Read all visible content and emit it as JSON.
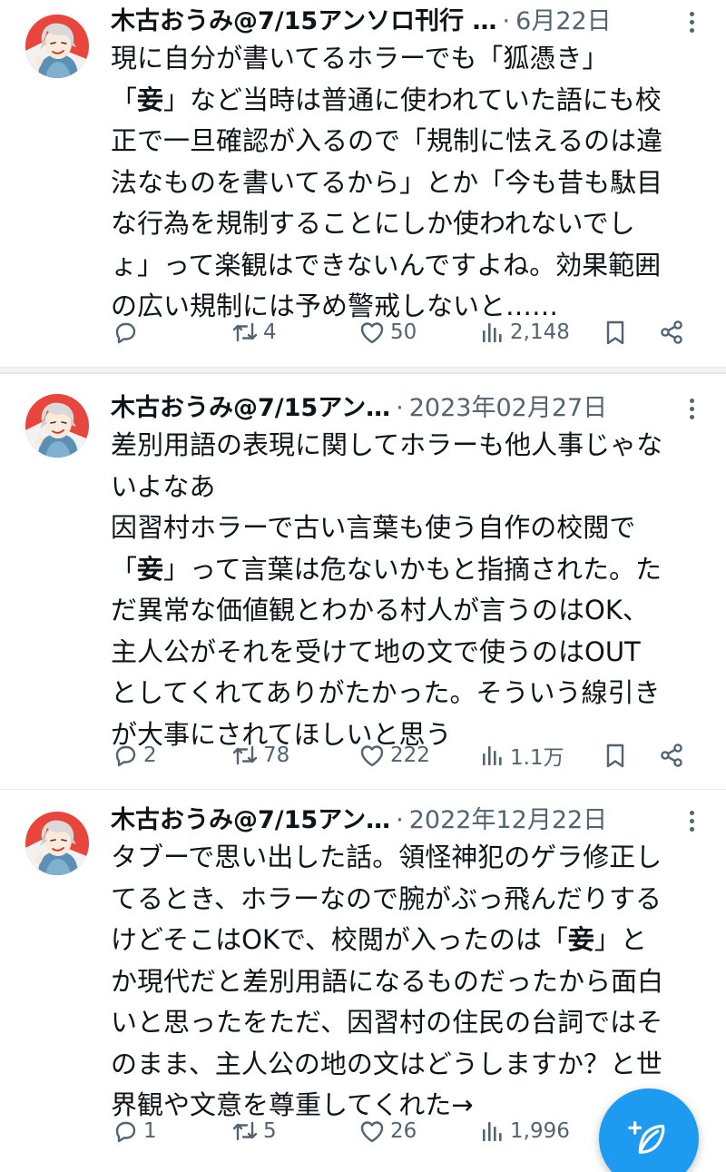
{
  "colors": {
    "accent": "#1d9bf0",
    "text": "#0f1419",
    "secondary": "#536471"
  },
  "tweets": [
    {
      "author": "木古おうみ@7/15アンソロ刊行 …",
      "separator": "·",
      "date": "6月22日",
      "lines": [
        [
          "現に自分が書いてるホラーでも「狐憑き」"
        ],
        [
          "「",
          "妾",
          "」など当時は普通に使われていた語にも校"
        ],
        [
          "正で一旦確認が入るので「規制に怯えるのは違"
        ],
        [
          "法なものを書いてるから」とか「今も昔も駄目"
        ],
        [
          "な行為を規制することにしか使われないでし"
        ],
        [
          "ょ」って楽観はできないんですよね。効果範囲"
        ],
        [
          "の広い規制には予め警戒しないと……"
        ]
      ],
      "stats": {
        "replies": "",
        "retweets": "4",
        "likes": "50",
        "views": "2,148"
      }
    },
    {
      "author": "木古おうみ@7/15アン…",
      "separator": "·",
      "date": "2023年02月27日",
      "lines": [
        [
          "差別用語の表現に関してホラーも他人事じゃな"
        ],
        [
          "いよなあ"
        ],
        [
          "因習村ホラーで古い言葉も使う自作の校閲で"
        ],
        [
          "「",
          "妾",
          "」って言葉は危ないかもと指摘された。た"
        ],
        [
          "だ異常な価値観とわかる村人が言うのはOK、"
        ],
        [
          "主人公がそれを受けて地の文で使うのはOUT"
        ],
        [
          "としてくれてありがたかった。そういう線引き"
        ],
        [
          "が大事にされてほしいと思う"
        ]
      ],
      "stats": {
        "replies": "2",
        "retweets": "78",
        "likes": "222",
        "views": "1.1万"
      }
    },
    {
      "author": "木古おうみ@7/15アン…",
      "separator": "·",
      "date": "2022年12月22日",
      "lines": [
        [
          "タブーで思い出した話。領怪神犯のゲラ修正し"
        ],
        [
          "てるとき、ホラーなので腕がぶっ飛んだりする"
        ],
        [
          "けどそこはOKで、校閲が入ったのは「",
          "妾",
          "」と"
        ],
        [
          "か現代だと差別用語になるものだったから面白"
        ],
        [
          "いと思ったをただ、因習村の住民の台詞ではそ"
        ],
        [
          "のまま、主人公の地の文はどうしますか？と世"
        ],
        [
          "界観や文意を尊重してくれた→"
        ]
      ],
      "stats": {
        "replies": "1",
        "retweets": "5",
        "likes": "26",
        "views": "1,996"
      }
    }
  ],
  "icons": {
    "reply": "reply-bubble-icon",
    "retweet": "retweet-arrows-icon",
    "like": "heart-icon",
    "views": "bar-chart-icon",
    "bookmark": "bookmark-icon",
    "share": "share-nodes-icon",
    "compose": "compose-feather-icon",
    "more": "more-vertical-icon"
  }
}
